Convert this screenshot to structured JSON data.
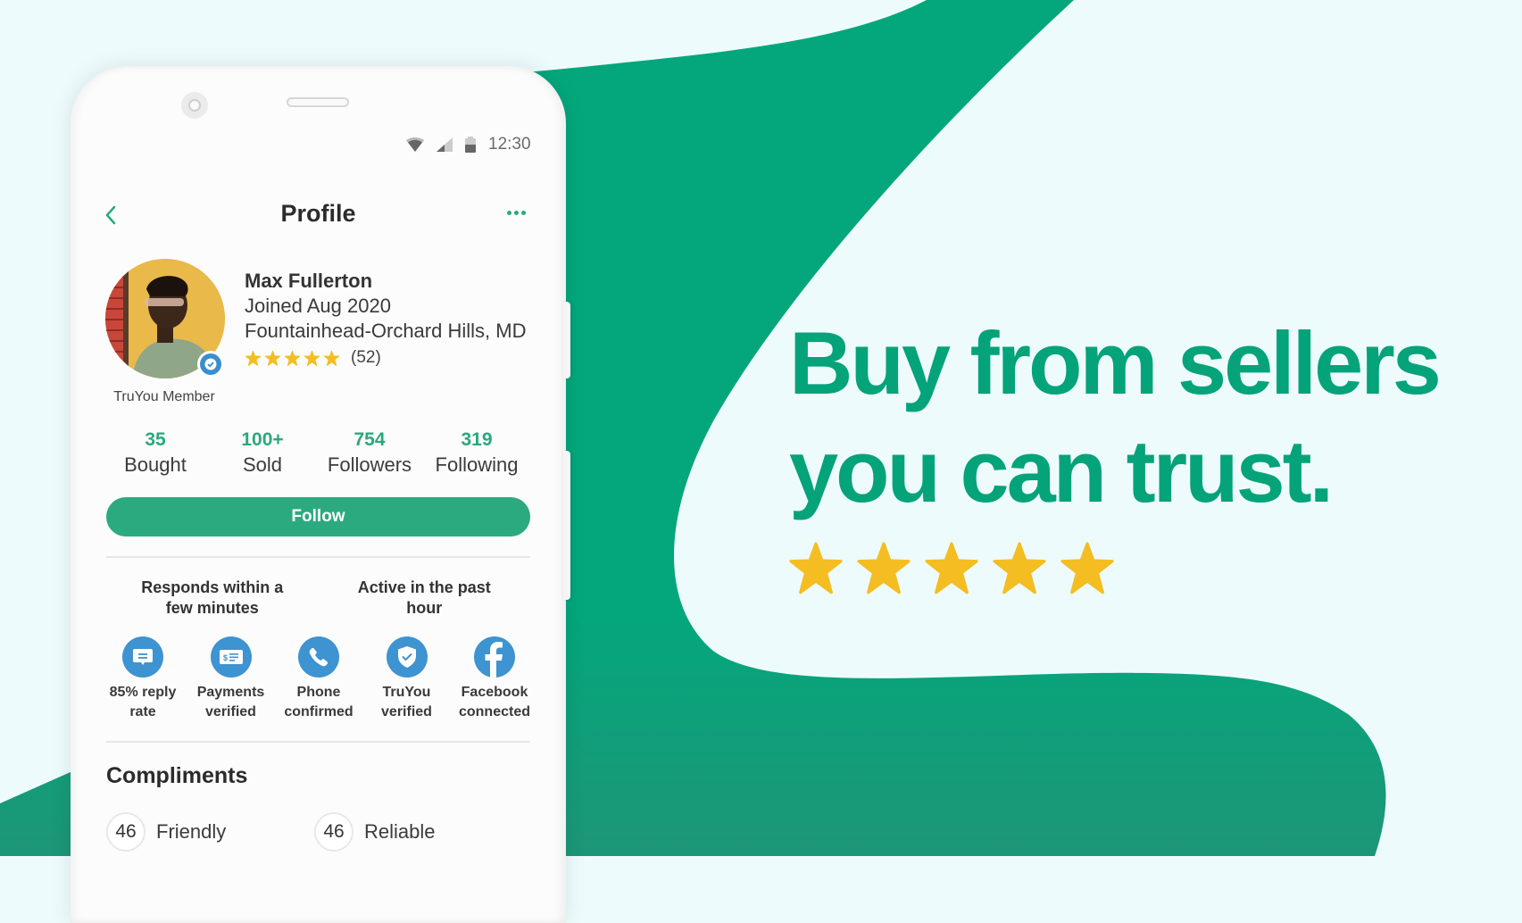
{
  "colors": {
    "background": "#EEFBFC",
    "brand_green": "#04A77C",
    "accent_green": "#2AA87E",
    "star_yellow": "#F4BE22",
    "badge_blue": "#3E93D1"
  },
  "status_bar": {
    "icons": [
      "wifi-icon",
      "signal-icon",
      "battery-icon"
    ],
    "time": "12:30"
  },
  "header": {
    "title": "Profile",
    "back_icon": "chevron-left-icon",
    "more_icon": "more-horizontal-icon"
  },
  "profile": {
    "name": "Max Fullerton",
    "joined": "Joined Aug 2020",
    "location": "Fountainhead-Orchard Hills, MD",
    "rating_stars": 5,
    "rating_max": 5,
    "rating_count": "(52)",
    "member_label": "TruYou Member"
  },
  "stats": [
    {
      "value": "35",
      "label": "Bought"
    },
    {
      "value": "100+",
      "label": "Sold"
    },
    {
      "value": "754",
      "label": "Followers"
    },
    {
      "value": "319",
      "label": "Following"
    }
  ],
  "follow_button": "Follow",
  "activity": {
    "responds": [
      "Responds within a",
      "few minutes"
    ],
    "active": [
      "Active in the past",
      "hour"
    ]
  },
  "badges": [
    {
      "icon": "message-icon",
      "line1": "85% reply",
      "line2": "rate"
    },
    {
      "icon": "payment-check-icon",
      "line1": "Payments",
      "line2": "verified"
    },
    {
      "icon": "phone-icon",
      "line1": "Phone",
      "line2": "confirmed"
    },
    {
      "icon": "shield-check-icon",
      "line1": "TruYou",
      "line2": "verified"
    },
    {
      "icon": "facebook-icon",
      "line1": "Facebook",
      "line2": "connected"
    }
  ],
  "compliments": {
    "title": "Compliments",
    "items": [
      {
        "count": "46",
        "label": "Friendly"
      },
      {
        "count": "46",
        "label": "Reliable"
      }
    ]
  },
  "promo": {
    "headline_line1": "Buy from sellers",
    "headline_line2": "you can trust.",
    "stars": 5
  }
}
